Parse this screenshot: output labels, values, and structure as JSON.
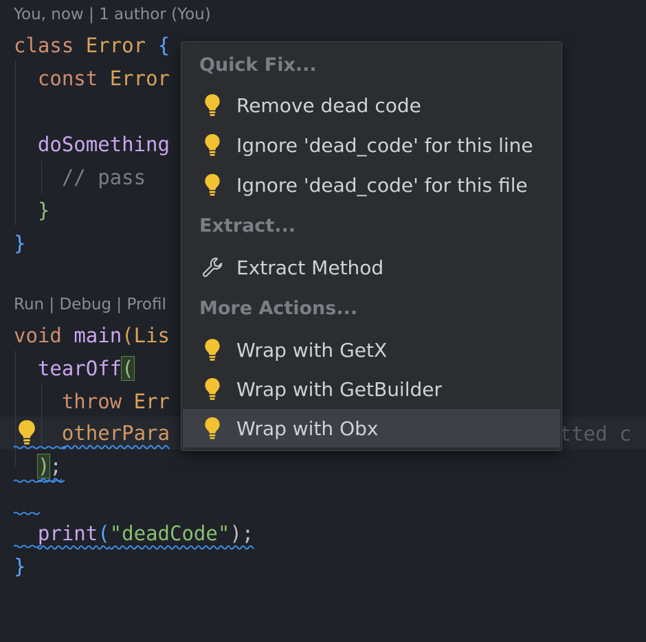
{
  "editor": {
    "codelens_top": "You, now | 1 author (You)",
    "codelens_main": "Run | Debug | Profil",
    "ghost_hint": "tted c",
    "code": {
      "l1_kw": "class",
      "l1_name": "Error",
      "l1_brace": "{",
      "l2_kw": "const",
      "l2_name": "Error",
      "l3_fn": "doSomething",
      "l4_comment": "// pass",
      "l5_brace": "}",
      "l6_brace": "}",
      "l7_kw": "void",
      "l7_fn": "main",
      "l7_paren": "(",
      "l7_rest": "Lis",
      "l8_fn": "tearOff",
      "l8_paren": "(",
      "l9_kw": "throw",
      "l9_rest": "Err",
      "l10_param": "otherPara",
      "l11_paren": ")",
      "l11_semi": ";",
      "l12_fn": "print",
      "l12_open": "(",
      "l12_str": "\"deadCode\"",
      "l12_close": ");",
      "l13_brace": "}"
    }
  },
  "popup": {
    "sections": [
      {
        "header": "Quick Fix...",
        "items": [
          {
            "label": "Remove dead code",
            "icon": "lightbulb-icon"
          },
          {
            "label": "Ignore 'dead_code' for this line",
            "icon": "lightbulb-icon"
          },
          {
            "label": "Ignore 'dead_code' for this file",
            "icon": "lightbulb-icon"
          }
        ]
      },
      {
        "header": "Extract...",
        "items": [
          {
            "label": "Extract Method",
            "icon": "wrench-icon"
          }
        ]
      },
      {
        "header": "More Actions...",
        "items": [
          {
            "label": "Wrap with GetX",
            "icon": "lightbulb-icon"
          },
          {
            "label": "Wrap with GetBuilder",
            "icon": "lightbulb-icon"
          },
          {
            "label": "Wrap with Obx",
            "icon": "lightbulb-icon",
            "selected": true
          }
        ]
      }
    ]
  },
  "colors": {
    "background": "#1f2228",
    "popup_bg": "#2b2d30",
    "selection": "#3d4046",
    "lightbulb": "#f2c233",
    "squiggle": "#3b8eea"
  }
}
